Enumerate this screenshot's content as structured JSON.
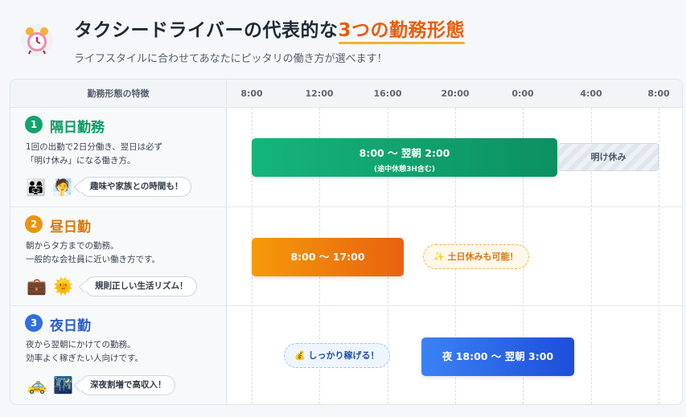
{
  "header": {
    "clock_icon": "alarm-clock-icon",
    "title_main": "タクシードライバーの代表的な",
    "title_accent": "3つの勤務形態",
    "subtitle": "ライフスタイルに合わせてあなたにピッタリの働き方が選べます！",
    "accent_color": "#e85d0c"
  },
  "table": {
    "feature_header": "勤務形態の特徴",
    "ticks": [
      "8:00",
      "12:00",
      "16:00",
      "20:00",
      "0:00",
      "4:00",
      "8:00"
    ]
  },
  "rows": [
    {
      "number": "1",
      "title": "隔日勤務",
      "color": "#12a36f",
      "desc_line1": "1回の出勤で2日分働き、翌日は必ず",
      "desc_line2": "「明け休み」になる働き方。",
      "icons": [
        "family-icon",
        "person-icon"
      ],
      "emoji1": "👨‍👩‍👧",
      "emoji2": "🧖",
      "tag": "趣味や家族との時間も！",
      "bar_label": "8:00 〜 翌朝 2:00",
      "bar_sub": "(途中休憩3H含む)",
      "rest_label": "明け休み"
    },
    {
      "number": "2",
      "title": "昼日勤",
      "color": "#e8860c",
      "desc_line1": "朝からタ方までの勤務。",
      "desc_line2": "一般的な会社員に近い働き方です。",
      "icons": [
        "briefcase-icon",
        "sun-icon"
      ],
      "emoji1": "💼",
      "emoji2": "🌞",
      "tag": "規則正しい生活リズム！",
      "bar_label": "8:00 〜 17:00",
      "note_icon": "sparkle-icon",
      "note_glyph": "✨",
      "note": "土日休みも可能！"
    },
    {
      "number": "3",
      "title": "夜日勤",
      "color": "#2f6fe0",
      "desc_line1": "夜から翌朝にかけての勤務。",
      "desc_line2": "効率よく稼ぎたい人向けです。",
      "icons": [
        "taxi-icon",
        "night-city-icon"
      ],
      "emoji1": "🚕",
      "emoji2": "🌃",
      "tag": "深夜割増で高収入！",
      "bar_label": "夜 18:00 〜 翌朝 3:00",
      "note_icon": "money-bag-icon",
      "note_glyph": "💰",
      "note": "しっかり稼げる！"
    }
  ]
}
